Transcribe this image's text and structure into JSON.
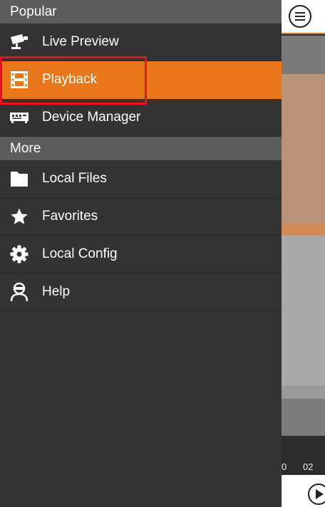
{
  "drawer": {
    "sections": [
      {
        "header": "Popular",
        "items": [
          {
            "label": "Live Preview",
            "icon": "cctv-camera-icon",
            "active": false
          },
          {
            "label": "Playback",
            "icon": "film-strip-icon",
            "active": true
          },
          {
            "label": "Device Manager",
            "icon": "dvr-device-icon",
            "active": false
          }
        ]
      },
      {
        "header": "More",
        "items": [
          {
            "label": "Local Files",
            "icon": "folder-icon",
            "active": false
          },
          {
            "label": "Favorites",
            "icon": "star-icon",
            "active": false
          },
          {
            "label": "Local Config",
            "icon": "gear-icon",
            "active": false
          },
          {
            "label": "Help",
            "icon": "support-agent-icon",
            "active": false
          }
        ]
      }
    ]
  },
  "background_app": {
    "timeline_ticks": [
      "0",
      "02"
    ]
  },
  "colors": {
    "accent": "#e8771b",
    "drawer_bg": "#333333",
    "section_header_bg": "#5c5c5c",
    "highlight_border": "#e0161c"
  }
}
